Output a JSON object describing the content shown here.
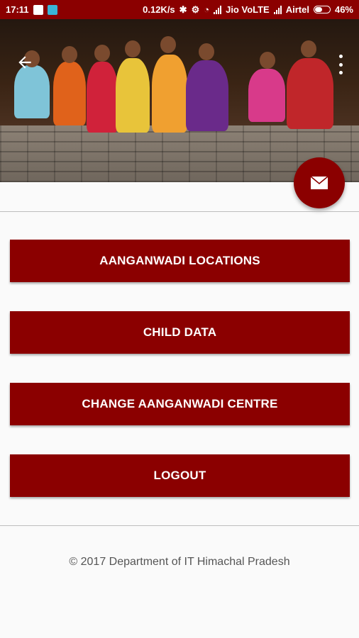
{
  "status": {
    "time": "17:11",
    "speed": "0.12K/s",
    "carrier1": "Jio VoLTE",
    "carrier2": "Airtel",
    "battery": "46%"
  },
  "menu": {
    "buttons": [
      "AANGANWADI LOCATIONS",
      "CHILD DATA",
      "CHANGE AANGANWADI CENTRE",
      "LOGOUT"
    ]
  },
  "footer": {
    "text": "© 2017 Department of IT Himachal Pradesh"
  },
  "colors": {
    "primary": "#8b0000",
    "background": "#fafafa"
  },
  "icons": [
    "back-arrow-icon",
    "more-vert-icon",
    "mail-icon"
  ]
}
